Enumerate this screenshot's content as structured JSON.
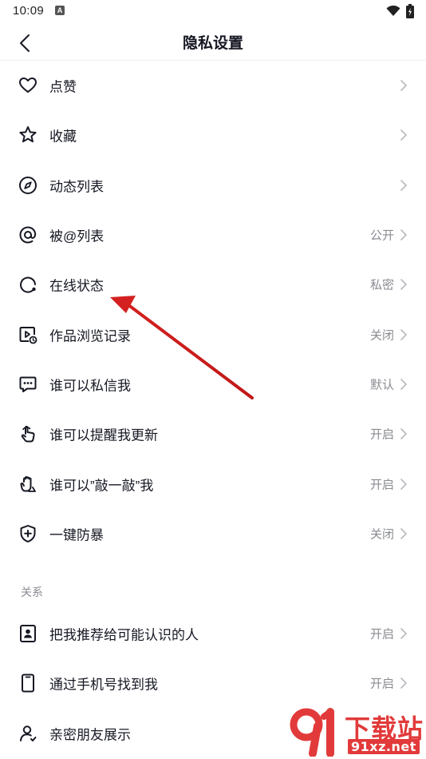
{
  "status_bar": {
    "time": "10:09",
    "badge": "A"
  },
  "nav": {
    "title": "隐私设置"
  },
  "items": [
    {
      "label": "点赞",
      "value": ""
    },
    {
      "label": "收藏",
      "value": ""
    },
    {
      "label": "动态列表",
      "value": ""
    },
    {
      "label": "被@列表",
      "value": "公开"
    },
    {
      "label": "在线状态",
      "value": "私密"
    },
    {
      "label": "作品浏览记录",
      "value": "关闭"
    },
    {
      "label": "谁可以私信我",
      "value": "默认"
    },
    {
      "label": "谁可以提醒我更新",
      "value": "开启"
    },
    {
      "label": "谁可以”敲一敲”我",
      "value": "开启"
    },
    {
      "label": "一键防暴",
      "value": "关闭"
    }
  ],
  "relations": {
    "title": "关系",
    "items": [
      {
        "label": "把我推荐给可能认识的人",
        "value": "开启"
      },
      {
        "label": "通过手机号找到我",
        "value": "开启"
      },
      {
        "label": "亲密朋友展示",
        "value": ""
      }
    ]
  },
  "watermark": {
    "text": "下载站",
    "url": "91xz.net"
  },
  "colors": {
    "arrow": "#d42020",
    "text": "#161823",
    "secondary": "#8a8b91"
  }
}
